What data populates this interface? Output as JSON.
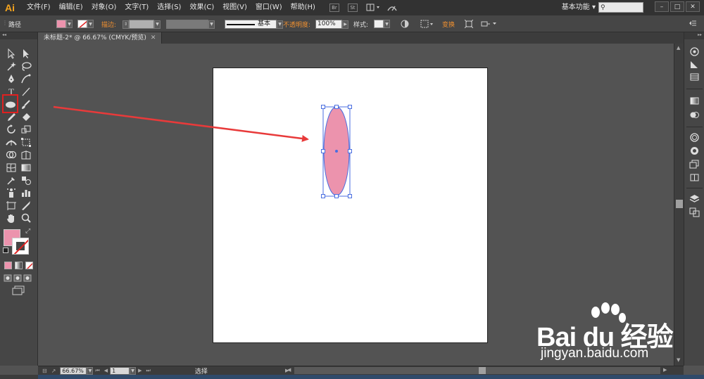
{
  "app": {
    "logo": "Ai"
  },
  "menu": [
    "文件(F)",
    "编辑(E)",
    "对象(O)",
    "文字(T)",
    "选择(S)",
    "效果(C)",
    "视图(V)",
    "窗口(W)",
    "帮助(H)"
  ],
  "menubar_icons": [
    "Br",
    "St"
  ],
  "workspace": "基本功能",
  "window_buttons": [
    "–",
    "□",
    "✕"
  ],
  "control": {
    "selection_label": "路径",
    "fill_color": "#ec93ad",
    "stroke_label": "描边",
    "stroke_style": "基本",
    "opacity_label": "不透明度",
    "opacity_value": "100%",
    "style_label": "样式",
    "transform_label": "变换"
  },
  "document": {
    "tab_title": "未标题-2* @ 66.67% (CMYK/预览)",
    "close": "✕"
  },
  "status": {
    "zoom": "66.67%",
    "page": "1",
    "tool_name": "选择"
  },
  "shape": {
    "fill": "#ec93ad",
    "selection_color": "#4a6ee0"
  },
  "annotation": {
    "highlight_color": "#e02020",
    "arrow_color": "#e83a3a"
  },
  "watermark": {
    "brand": "Bai du 经验",
    "url": "jingyan.baidu.com"
  },
  "icons": {
    "tools": [
      "selection-icon",
      "direct-selection-icon",
      "magic-wand-icon",
      "lasso-icon",
      "pen-icon",
      "curvature-icon",
      "type-icon",
      "line-icon",
      "ellipse-icon",
      "paintbrush-icon",
      "pencil-icon",
      "blob-brush-icon",
      "rotate-icon",
      "scale-icon",
      "width-icon",
      "free-transform-icon",
      "shape-builder-icon",
      "perspective-icon",
      "mesh-icon",
      "gradient-icon",
      "eyedropper-icon",
      "blend-icon",
      "symbol-sprayer-icon",
      "column-graph-icon",
      "artboard-icon",
      "slice-icon",
      "hand-icon",
      "zoom-icon"
    ]
  }
}
